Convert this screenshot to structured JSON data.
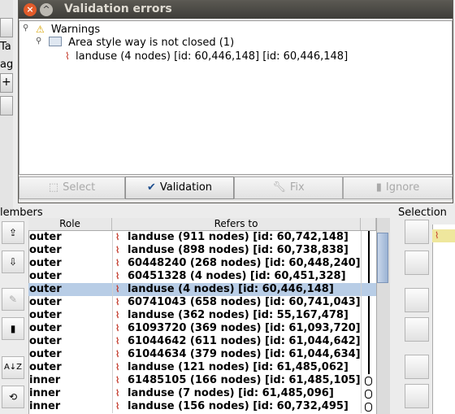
{
  "dialog": {
    "title": "Validation errors",
    "tree": {
      "root_label": "Warnings",
      "group_label": "Area style way is not closed (1)",
      "item_label": "landuse (4 nodes) [id: 60,446,148] [id: 60,446,148]"
    },
    "buttons": {
      "select": "Select",
      "validation": "Validation",
      "fix": "Fix",
      "ignore": "Ignore"
    }
  },
  "background_editor": {
    "left_labels": [
      "Ta",
      "ag"
    ]
  },
  "members_panel": {
    "title": "lembers",
    "columns": {
      "role": "Role",
      "refers_to": "Refers to"
    },
    "rows": [
      {
        "role": "outer",
        "ref": "landuse (911 nodes) [id: 60,742,148]",
        "link": "line"
      },
      {
        "role": "outer",
        "ref": "landuse (898 nodes) [id: 60,738,838]",
        "link": "line"
      },
      {
        "role": "outer",
        "ref": "60448240 (268 nodes) [id: 60,448,240]",
        "link": "line"
      },
      {
        "role": "outer",
        "ref": "60451328 (4 nodes) [id: 60,451,328]",
        "link": "line"
      },
      {
        "role": "outer",
        "ref": "landuse (4 nodes) [id: 60,446,148]",
        "link": "none"
      },
      {
        "role": "outer",
        "ref": "60741043 (658 nodes) [id: 60,741,043]",
        "link": "line"
      },
      {
        "role": "outer",
        "ref": "landuse (362 nodes) [id: 55,167,478]",
        "link": "line"
      },
      {
        "role": "outer",
        "ref": "61093720 (369 nodes) [id: 61,093,720]",
        "link": "line"
      },
      {
        "role": "outer",
        "ref": "61044642 (611 nodes) [id: 61,044,642]",
        "link": "line"
      },
      {
        "role": "outer",
        "ref": "61044634 (379 nodes) [id: 61,044,634]",
        "link": "line"
      },
      {
        "role": "outer",
        "ref": "landuse (121 nodes) [id: 61,485,062]",
        "link": "line"
      },
      {
        "role": "inner",
        "ref": "61485105 (166 nodes) [id: 61,485,105]",
        "link": "loop"
      },
      {
        "role": "inner",
        "ref": "landuse (7 nodes) [id: 61,485,096]",
        "link": "loop"
      },
      {
        "role": "inner",
        "ref": "landuse (156 nodes) [id: 60,732,495]",
        "link": "loop"
      }
    ],
    "selected_row_index": 4
  },
  "selection_panel": {
    "title": "Selection"
  },
  "colors": {
    "titlebar": "#45443f",
    "close_button": "#e25b2a",
    "selected_row": "#b8cde6",
    "way_icon": "#c03020",
    "selection_item": "#efe79d"
  },
  "icons": {
    "warning": "warning-icon",
    "folder": "folder-icon",
    "way": "way-icon",
    "validation": "checkmark-icon",
    "fix": "wrench-icon",
    "ignore": "trash-icon"
  }
}
